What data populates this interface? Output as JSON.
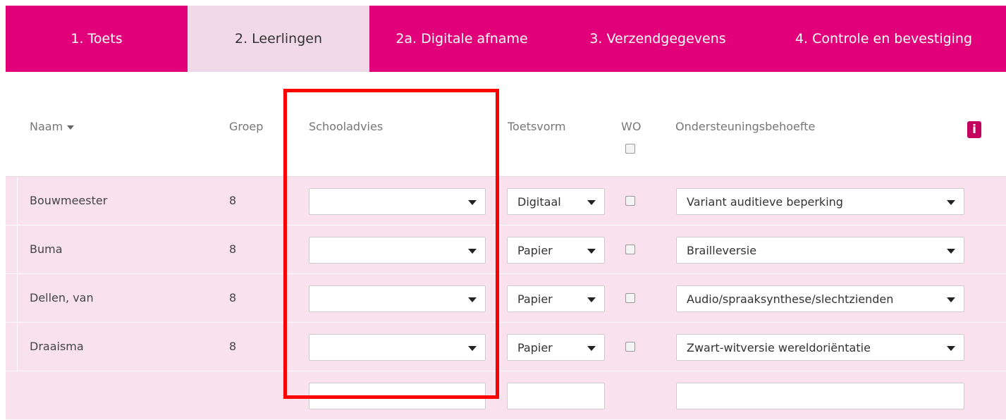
{
  "tabs": [
    {
      "label": "1. Toets"
    },
    {
      "label": "2. Leerlingen"
    },
    {
      "label": "2a. Digitale afname"
    },
    {
      "label": "3. Verzendgegevens"
    },
    {
      "label": "4. Controle en bevestiging"
    }
  ],
  "table": {
    "headers": {
      "naam": "Naam",
      "groep": "Groep",
      "schooladvies": "Schooladvies",
      "toetsvorm": "Toetsvorm",
      "wo": "WO",
      "ondersteuning": "Ondersteuningsbehoefte",
      "info": "i"
    },
    "rows": [
      {
        "naam": "Bouwmeester",
        "groep": "8",
        "schooladvies": "",
        "toetsvorm": "Digitaal",
        "ondersteuning": "Variant auditieve beperking"
      },
      {
        "naam": "Buma",
        "groep": "8",
        "schooladvies": "",
        "toetsvorm": "Papier",
        "ondersteuning": "Brailleversie"
      },
      {
        "naam": "Dellen, van",
        "groep": "8",
        "schooladvies": "",
        "toetsvorm": "Papier",
        "ondersteuning": "Audio/spraaksynthese/slechtzienden"
      },
      {
        "naam": "Draaisma",
        "groep": "8",
        "schooladvies": "",
        "toetsvorm": "Papier",
        "ondersteuning": "Zwart-witversie wereldoriëntatie"
      }
    ]
  },
  "colors": {
    "accent": "#e2007a",
    "active_tab": "#f2d9e7",
    "row_bg": "#f9e2ee",
    "highlight": "#ff0000"
  }
}
